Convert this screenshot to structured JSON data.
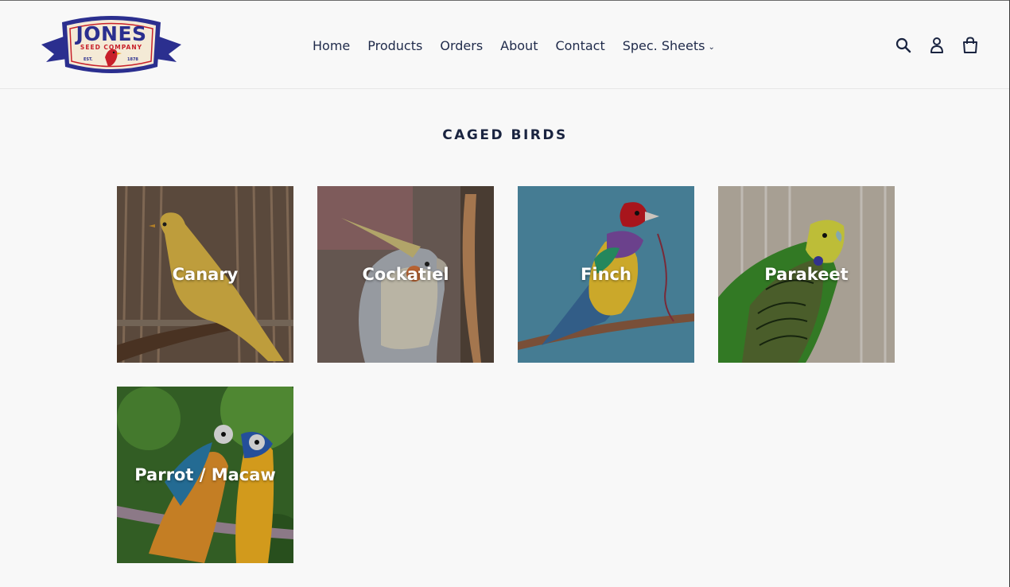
{
  "brand": {
    "name": "JONES",
    "tagline": "SEED COMPANY",
    "est_left": "EST.",
    "est_right": "1878",
    "colors": {
      "navy": "#2b2f8f",
      "red": "#c8202a",
      "cream": "#f4ead6"
    }
  },
  "nav": {
    "items": [
      {
        "label": "Home"
      },
      {
        "label": "Products"
      },
      {
        "label": "Orders"
      },
      {
        "label": "About"
      },
      {
        "label": "Contact"
      },
      {
        "label": "Spec. Sheets",
        "has_dropdown": true
      }
    ]
  },
  "header_icons": [
    "search-icon",
    "account-icon",
    "cart-icon"
  ],
  "page": {
    "title": "CAGED BIRDS"
  },
  "collections": [
    {
      "label": "Canary"
    },
    {
      "label": "Cockatiel"
    },
    {
      "label": "Finch"
    },
    {
      "label": "Parakeet"
    },
    {
      "label": "Parrot / Macaw"
    }
  ]
}
